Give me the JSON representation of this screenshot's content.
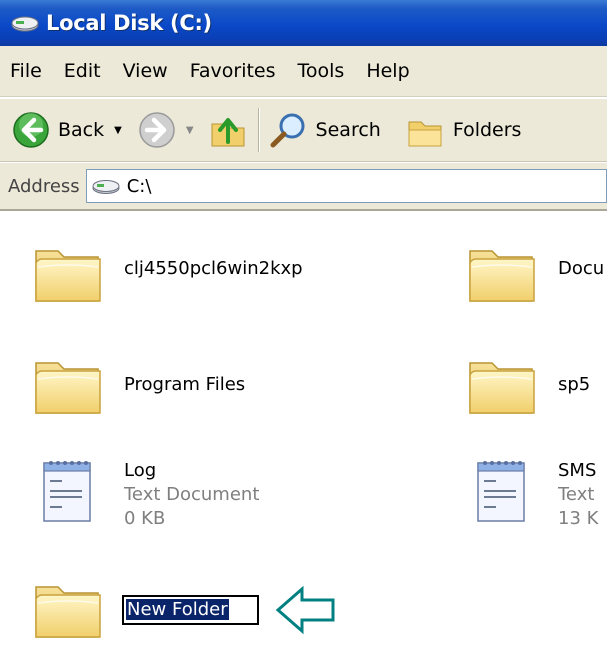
{
  "window": {
    "title": "Local Disk (C:)"
  },
  "menu": {
    "items": [
      "File",
      "Edit",
      "View",
      "Favorites",
      "Tools",
      "Help"
    ]
  },
  "toolbar": {
    "back_label": "Back",
    "search_label": "Search",
    "folders_label": "Folders"
  },
  "address": {
    "label": "Address",
    "value": "C:\\"
  },
  "files": [
    {
      "name": "clj4550pcl6win2kxp",
      "type": "folder"
    },
    {
      "name": "Docu",
      "type": "folder"
    },
    {
      "name": "Program Files",
      "type": "folder"
    },
    {
      "name": "sp5",
      "type": "folder"
    },
    {
      "name": "Log",
      "type": "text",
      "desc": "Text Document",
      "size": "0 KB"
    },
    {
      "name": "SMS",
      "type": "text",
      "desc": "Text",
      "size": "13 K"
    }
  ],
  "new_folder": {
    "name": "New Folder"
  },
  "colors": {
    "title_bar": "#0a48c8",
    "selection": "#0a246a",
    "arrow": "#008080"
  }
}
